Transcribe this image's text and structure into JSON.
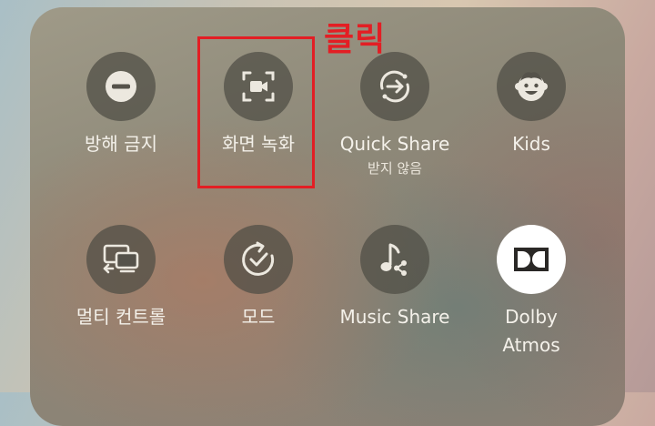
{
  "annotation": {
    "text": "클릭"
  },
  "tiles": [
    {
      "label": "방해 금지",
      "sub": "",
      "icon": "do-not-disturb-icon",
      "active": false
    },
    {
      "label": "화면 녹화",
      "sub": "",
      "icon": "screen-record-icon",
      "active": false
    },
    {
      "label": "Quick Share",
      "sub": "받지 않음",
      "icon": "quick-share-icon",
      "active": false
    },
    {
      "label": "Kids",
      "sub": "",
      "icon": "kids-icon",
      "active": false
    },
    {
      "label": "멀티 컨트롤",
      "sub": "",
      "icon": "multi-control-icon",
      "active": false
    },
    {
      "label": "모드",
      "sub": "",
      "icon": "modes-icon",
      "active": false
    },
    {
      "label": "Music Share",
      "sub": "",
      "icon": "music-share-icon",
      "active": false
    },
    {
      "label": "Dolby Atmos",
      "sub": "",
      "icon": "dolby-atmos-icon",
      "active": true
    }
  ],
  "colors": {
    "annotation": "#e31e24",
    "active_tile": "#ffffff"
  }
}
